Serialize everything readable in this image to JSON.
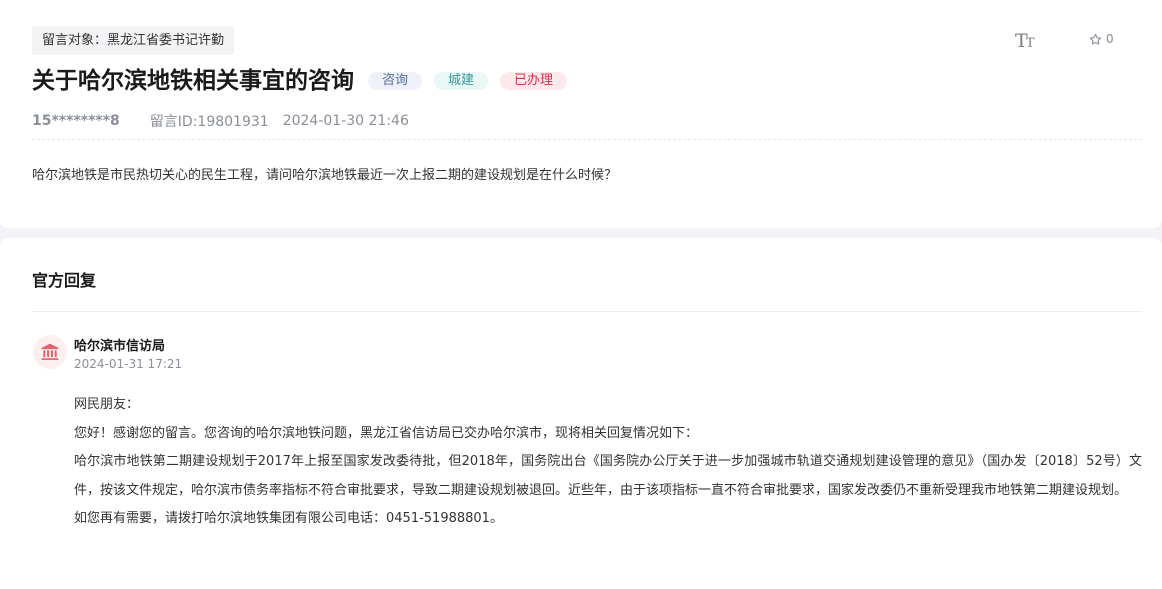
{
  "message": {
    "target": "留言对象：黑龙江省委书记许勤",
    "title": "关于哈尔滨地铁相关事宜的咨询",
    "tags": {
      "category": "咨询",
      "type": "城建",
      "status": "已办理"
    },
    "user": "15********8",
    "id_label": "留言ID:19801931",
    "time": "2024-01-30 21:46",
    "content": "哈尔滨地铁是市民热切关心的民生工程，请问哈尔滨地铁最近一次上报二期的建设规划是在什么时候？"
  },
  "toolbar": {
    "font_icon_big": "T",
    "font_icon_small": "T",
    "favorite_count": "0"
  },
  "reply": {
    "heading": "官方回复",
    "department": "哈尔滨市信访局",
    "time": "2024-01-31 17:21",
    "paragraphs": [
      "网民朋友：",
      "您好！感谢您的留言。您咨询的哈尔滨地铁问题，黑龙江省信访局已交办哈尔滨市，现将相关回复情况如下：",
      "哈尔滨市地铁第二期建设规划于2017年上报至国家发改委待批，但2018年，国务院出台《国务院办公厅关于进一步加强城市轨道交通规划建设管理的意见》（国办发〔2018〕52号）文件，按该文件规定，哈尔滨市债务率指标不符合审批要求，导致二期建设规划被退回。近些年，由于该项指标一直不符合审批要求，国家发改委仍不重新受理我市地铁第二期建设规划。",
      "如您再有需要，请拨打哈尔滨地铁集团有限公司电话：0451-51988801。"
    ]
  },
  "colors": {
    "status_red": "#d4344d",
    "type_teal": "#3a9a94",
    "consult_blue": "#5a6e9a"
  },
  "icons": {
    "font": "font-size-icon",
    "favorite": "star-icon",
    "department": "government-building-icon"
  }
}
